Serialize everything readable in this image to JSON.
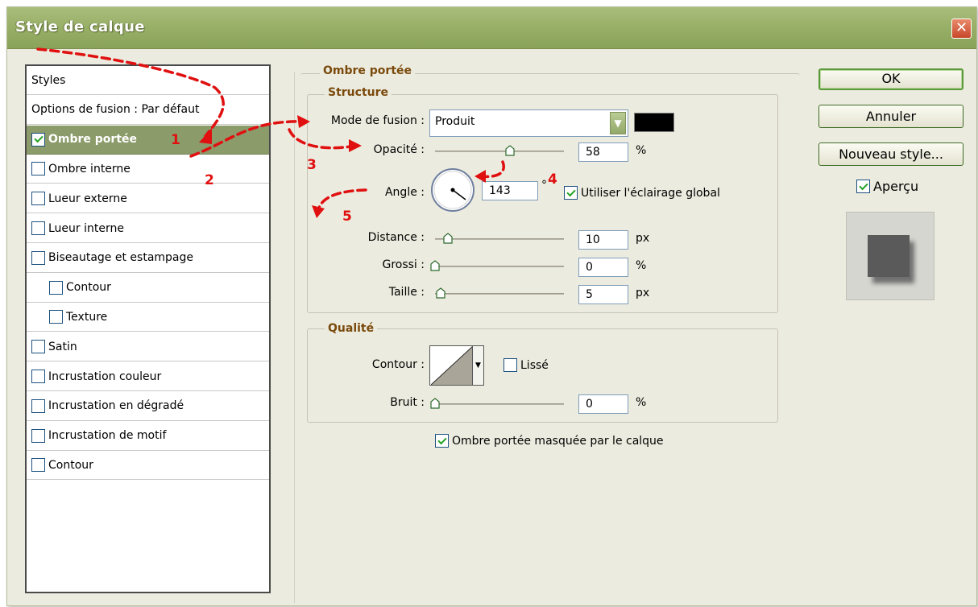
{
  "window": {
    "title": "Style de calque",
    "close_label": "✕"
  },
  "styles_list": {
    "items": [
      {
        "label": "Styles",
        "checkbox": false,
        "checked": false,
        "indent": false,
        "selected": false
      },
      {
        "label": "Options de fusion : Par défaut",
        "checkbox": false,
        "checked": false,
        "indent": false,
        "selected": false
      },
      {
        "label": "Ombre portée",
        "checkbox": true,
        "checked": true,
        "indent": false,
        "selected": true
      },
      {
        "label": "Ombre interne",
        "checkbox": true,
        "checked": false,
        "indent": false,
        "selected": false
      },
      {
        "label": "Lueur externe",
        "checkbox": true,
        "checked": false,
        "indent": false,
        "selected": false
      },
      {
        "label": "Lueur interne",
        "checkbox": true,
        "checked": false,
        "indent": false,
        "selected": false
      },
      {
        "label": "Biseautage et estampage",
        "checkbox": true,
        "checked": false,
        "indent": false,
        "selected": false
      },
      {
        "label": "Contour",
        "checkbox": true,
        "checked": false,
        "indent": true,
        "selected": false
      },
      {
        "label": "Texture",
        "checkbox": true,
        "checked": false,
        "indent": true,
        "selected": false
      },
      {
        "label": "Satin",
        "checkbox": true,
        "checked": false,
        "indent": false,
        "selected": false
      },
      {
        "label": "Incrustation couleur",
        "checkbox": true,
        "checked": false,
        "indent": false,
        "selected": false
      },
      {
        "label": "Incrustation en dégradé",
        "checkbox": true,
        "checked": false,
        "indent": false,
        "selected": false
      },
      {
        "label": "Incrustation de motif",
        "checkbox": true,
        "checked": false,
        "indent": false,
        "selected": false
      },
      {
        "label": "Contour",
        "checkbox": true,
        "checked": false,
        "indent": false,
        "selected": false
      }
    ]
  },
  "drop_shadow": {
    "section_title": "Ombre portée",
    "structure_title": "Structure",
    "blend_mode_label": "Mode de fusion :",
    "blend_mode_value": "Produit",
    "shadow_color": "#000000",
    "opacity_label": "Opacité :",
    "opacity_value": "58",
    "opacity_unit": "%",
    "opacity_fraction": 0.58,
    "angle_label": "Angle :",
    "angle_value": "143",
    "angle_unit": "°",
    "global_light_label": "Utiliser l'éclairage global",
    "global_light_checked": true,
    "distance_label": "Distance :",
    "distance_value": "10",
    "distance_unit": "px",
    "spread_label": "Grossi :",
    "spread_value": "0",
    "spread_unit": "%",
    "size_label": "Taille :",
    "size_value": "5",
    "size_unit": "px",
    "quality_title": "Qualité",
    "contour_label": "Contour :",
    "antialias_label": "Lissé",
    "antialias_checked": false,
    "noise_label": "Bruit :",
    "noise_value": "0",
    "noise_unit": "%",
    "knockout_label": "Ombre portée masquée par le calque",
    "knockout_checked": true
  },
  "buttons": {
    "ok": "OK",
    "cancel": "Annuler",
    "new_style": "Nouveau style...",
    "preview_label": "Aperçu",
    "preview_checked": true
  },
  "annotations": [
    "1",
    "2",
    "3",
    "4",
    "5"
  ]
}
